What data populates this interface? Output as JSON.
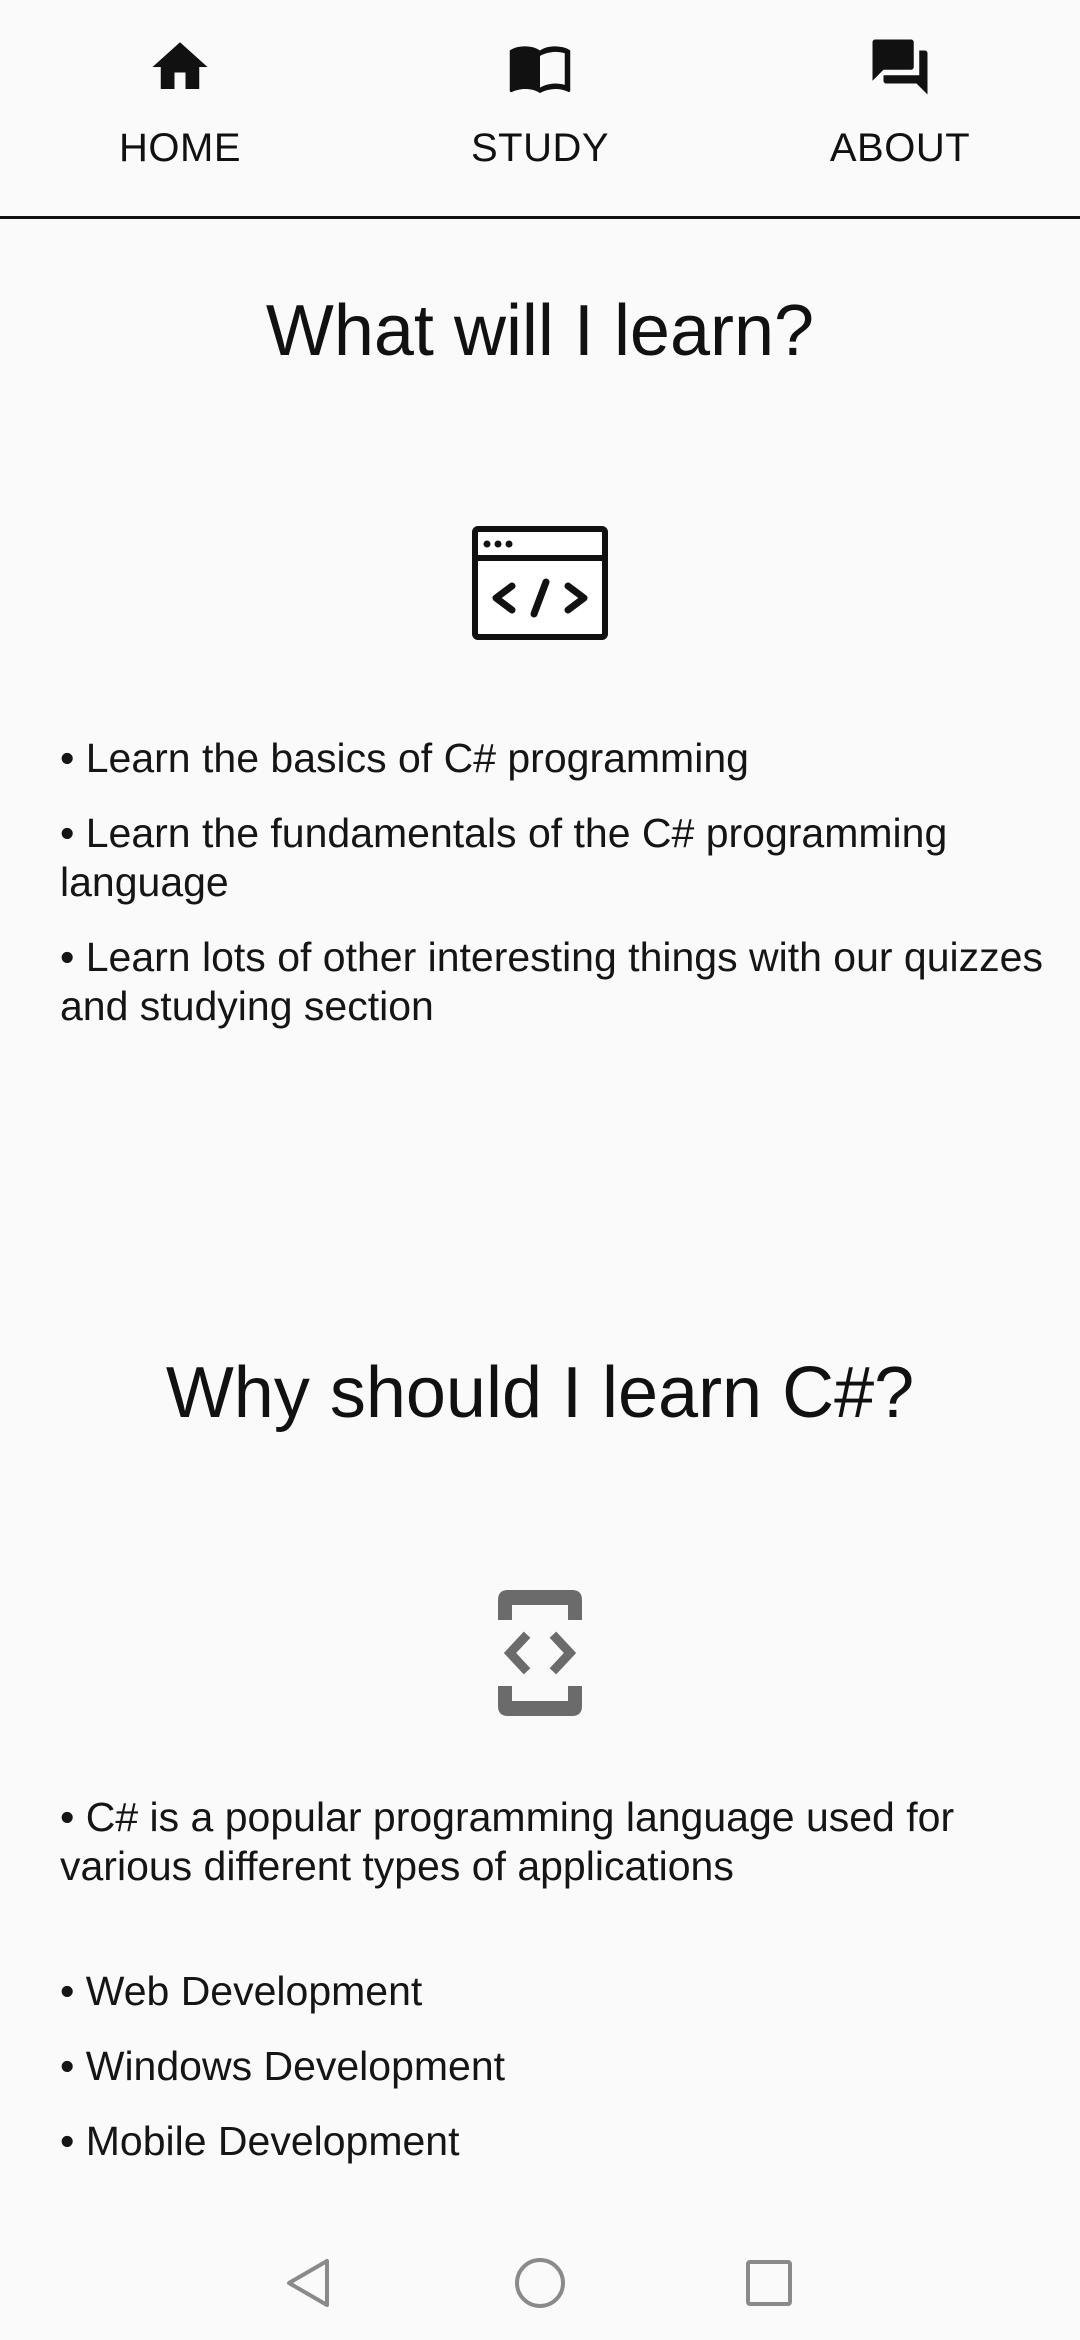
{
  "nav": {
    "tabs": [
      {
        "label": "HOME",
        "icon": "home-icon"
      },
      {
        "label": "STUDY",
        "icon": "book-icon"
      },
      {
        "label": "ABOUT",
        "icon": "forum-icon"
      }
    ]
  },
  "section1": {
    "title": "What will I learn?",
    "icon": "code-window-icon",
    "bullets": [
      "Learn the basics of C# programming",
      "Learn the fundamentals of the C# programming language",
      "Learn lots of other interesting things with our quizzes and studying section"
    ]
  },
  "section2": {
    "title": "Why should I learn C#?",
    "icon": "developer-mode-icon",
    "intro": "C# is a popular programming language used for various different types of applications",
    "bullets": [
      "Web Development",
      "Windows Development",
      "Mobile Development"
    ]
  },
  "system_nav": {
    "back": "back-icon",
    "home": "home-circle-icon",
    "recents": "recents-icon"
  },
  "colors": {
    "background": "#fafafa",
    "text": "#111111",
    "icon_gray": "#6b6b6b"
  }
}
